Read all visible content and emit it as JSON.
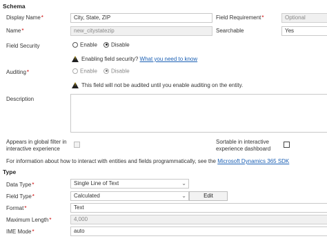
{
  "schema": {
    "title": "Schema",
    "display_name": {
      "label": "Display Name",
      "value": "City, State, ZIP"
    },
    "name": {
      "label": "Name",
      "value": "new_citystatezip"
    },
    "field_requirement": {
      "label": "Field Requirement",
      "value": "Optional"
    },
    "searchable": {
      "label": "Searchable",
      "value": "Yes"
    },
    "field_security": {
      "label": "Field Security",
      "enable": "Enable",
      "disable": "Disable",
      "selected": "Disable"
    },
    "field_security_warning": {
      "text": "Enabling field security?",
      "link": "What you need to know"
    },
    "auditing": {
      "label": "Auditing",
      "enable": "Enable",
      "disable": "Disable",
      "selected": "Disable"
    },
    "auditing_warning": "This field will not be audited until you enable auditing on the entity.",
    "description": {
      "label": "Description",
      "value": ""
    },
    "global_filter": {
      "label_line1": "Appears in global filter in",
      "label_line2": "interactive experience"
    },
    "sortable": {
      "label_line1": "Sortable in interactive",
      "label_line2": "experience dashboard"
    },
    "sdk_info": {
      "text": "For information about how to interact with entities and fields programmatically, see the",
      "link": "Microsoft Dynamics 365 SDK"
    }
  },
  "type": {
    "title": "Type",
    "data_type": {
      "label": "Data Type",
      "value": "Single Line of Text"
    },
    "field_type": {
      "label": "Field Type",
      "value": "Calculated",
      "edit_label": "Edit"
    },
    "format": {
      "label": "Format",
      "value": "Text"
    },
    "max_length": {
      "label": "Maximum Length",
      "value": "4,000"
    },
    "ime_mode": {
      "label": "IME Mode",
      "value": "auto"
    }
  },
  "icons": {
    "required_marker": "*",
    "chevron": "⌄"
  }
}
